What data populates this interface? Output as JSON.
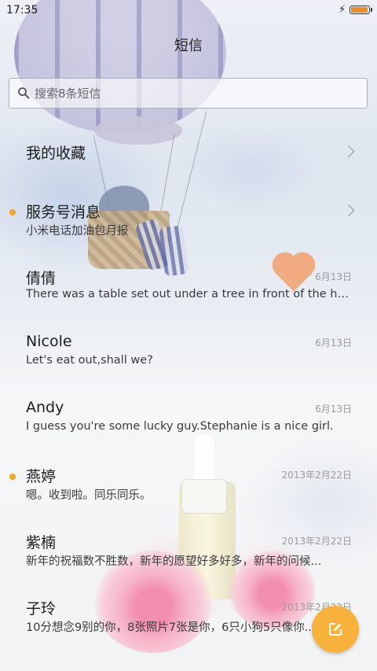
{
  "status_bar": {
    "time": "17:35",
    "battery_level": 0.95,
    "charging": true,
    "accent_color": "#f08a22"
  },
  "header": {
    "title": "短信"
  },
  "search": {
    "placeholder": "搜索8条短信"
  },
  "conversations": [
    {
      "name": "我的收藏",
      "preview": "",
      "date": "",
      "unread": false,
      "chevron": true
    },
    {
      "name": "服务号消息",
      "preview": "小米电话加油包月报",
      "date": "",
      "unread": true,
      "chevron": true
    },
    {
      "name": "倩倩",
      "preview": "There was a table set out under a tree in front of the ho...",
      "date": "6月13日",
      "unread": false,
      "chevron": false
    },
    {
      "name": "Nicole",
      "preview": "Let's eat out,shall we?",
      "date": "6月13日",
      "unread": false,
      "chevron": false
    },
    {
      "name": "Andy",
      "preview": "I guess you're some lucky guy.Stephanie is a nice girl.",
      "date": "6月13日",
      "unread": false,
      "chevron": false
    },
    {
      "name": "燕婷",
      "preview": "嗯。收到啦。同乐同乐。",
      "date": "2013年2月22日",
      "unread": true,
      "chevron": false
    },
    {
      "name": "紫楠",
      "preview": "新年的祝福数不胜数，新年的愿望好多好多，新年的问候...",
      "date": "2013年2月22日",
      "unread": false,
      "chevron": false
    },
    {
      "name": "子玲",
      "preview": "10分想念9别的你，8张照片7张是你，6只小狗5只像你...",
      "date": "2013年2月22日",
      "unread": false,
      "chevron": false
    }
  ],
  "compose_button": {
    "icon": "edit-icon",
    "color": "#f8b23b"
  },
  "colors": {
    "unread_dot": "#f5a623"
  }
}
